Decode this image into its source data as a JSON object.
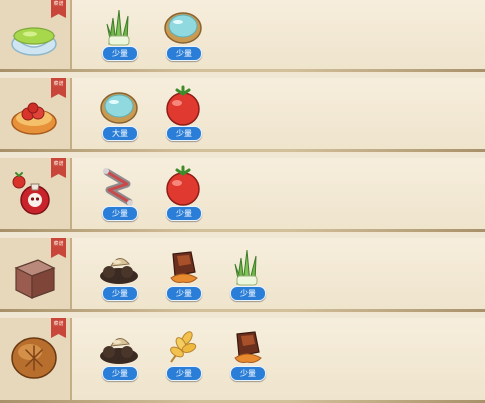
{
  "badge_label": "菜谱",
  "recipes": [
    {
      "dish_icon": "green-soup-bowl-icon",
      "ingredients": [
        {
          "icon": "scallion-icon",
          "qty": "少量"
        },
        {
          "icon": "water-bowl-icon",
          "qty": "少量"
        }
      ]
    },
    {
      "dish_icon": "tomato-dish-icon",
      "ingredients": [
        {
          "icon": "water-bowl-icon",
          "qty": "大量"
        },
        {
          "icon": "tomato-icon",
          "qty": "少量"
        }
      ]
    },
    {
      "dish_icon": "tomato-skull-bottle-icon",
      "ingredients": [
        {
          "icon": "red-bone-icon",
          "qty": "少量"
        },
        {
          "icon": "tomato-icon",
          "qty": "少量"
        }
      ]
    },
    {
      "dish_icon": "meat-cube-icon",
      "ingredients": [
        {
          "icon": "mushroom-pile-icon",
          "qty": "少量"
        },
        {
          "icon": "roasted-meat-icon",
          "qty": "少量"
        },
        {
          "icon": "scallion-icon",
          "qty": "少量"
        }
      ]
    },
    {
      "dish_icon": "bread-bun-icon",
      "ingredients": [
        {
          "icon": "mushroom-pile-icon",
          "qty": "少量"
        },
        {
          "icon": "wheat-icon",
          "qty": "少量"
        },
        {
          "icon": "roasted-meat-icon",
          "qty": "少量"
        }
      ]
    }
  ]
}
